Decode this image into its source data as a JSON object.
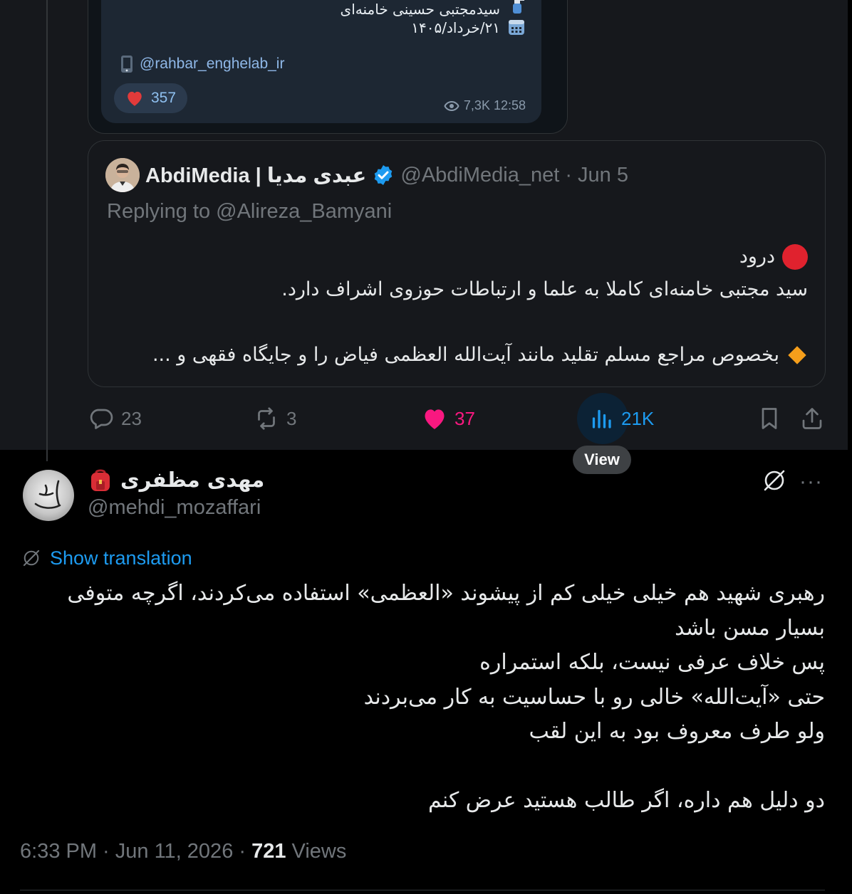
{
  "telegram_card": {
    "line1": "سیدمجتبی حسینی خامنه‌ای",
    "line2": "۲۱/خرداد/۱۴۰۵",
    "handle": "@rahbar_enghelab_ir",
    "reaction_count": "357",
    "views_time": "7,3K 12:58"
  },
  "quoted_tweet": {
    "name": "AbdiMedia | عبدی مدیا",
    "handle_date": "@AbdiMedia_net · Jun 5",
    "replying_to": "Replying to @Alireza_Bamyani",
    "line1": "درود",
    "line2": "سید مجتبی خامنه‌ای کاملا به علما و ارتباطات حوزوی اشراف دارد.",
    "line3": "بخصوص مراجع مسلم تقلید مانند آیت‌الله العظمی فیاض را و جایگاه فقهی و ..."
  },
  "actions": {
    "replies": "23",
    "reposts": "3",
    "likes": "37",
    "views": "21K",
    "tooltip": "View"
  },
  "main_tweet": {
    "name": "مهدی مظفری",
    "handle": "@mehdi_mozaffari",
    "show_translation": "Show translation",
    "lines": [
      "رهبری شهید هم خیلی خیلی کم از پیشوند «العظمی» استفاده می‌کردند، اگرچه متوفی",
      "بسیار مسن باشد",
      "پس خلاف عرفی نیست، بلکه استمراره",
      "حتی «آیت‌الله» خالی رو با حساسیت به کار می‌بردند",
      "ولو طرف معروف بود به این لقب",
      "",
      "دو دلیل هم داره، اگر طالب هستید عرض کنم"
    ],
    "time_date": "6:33 PM · Jun 11, 2026 · ",
    "view_count": "721",
    "views_label": " Views"
  },
  "colors": {
    "accent": "#1d9bf0",
    "like": "#f91880",
    "muted": "#71767b",
    "verified": "#1d9bf0"
  },
  "icons": [
    "reply-icon",
    "repost-icon",
    "heart-icon",
    "views-icon",
    "bookmark-icon",
    "share-icon",
    "grok-icon",
    "more-icon",
    "translate-icon",
    "verified-badge-icon"
  ]
}
